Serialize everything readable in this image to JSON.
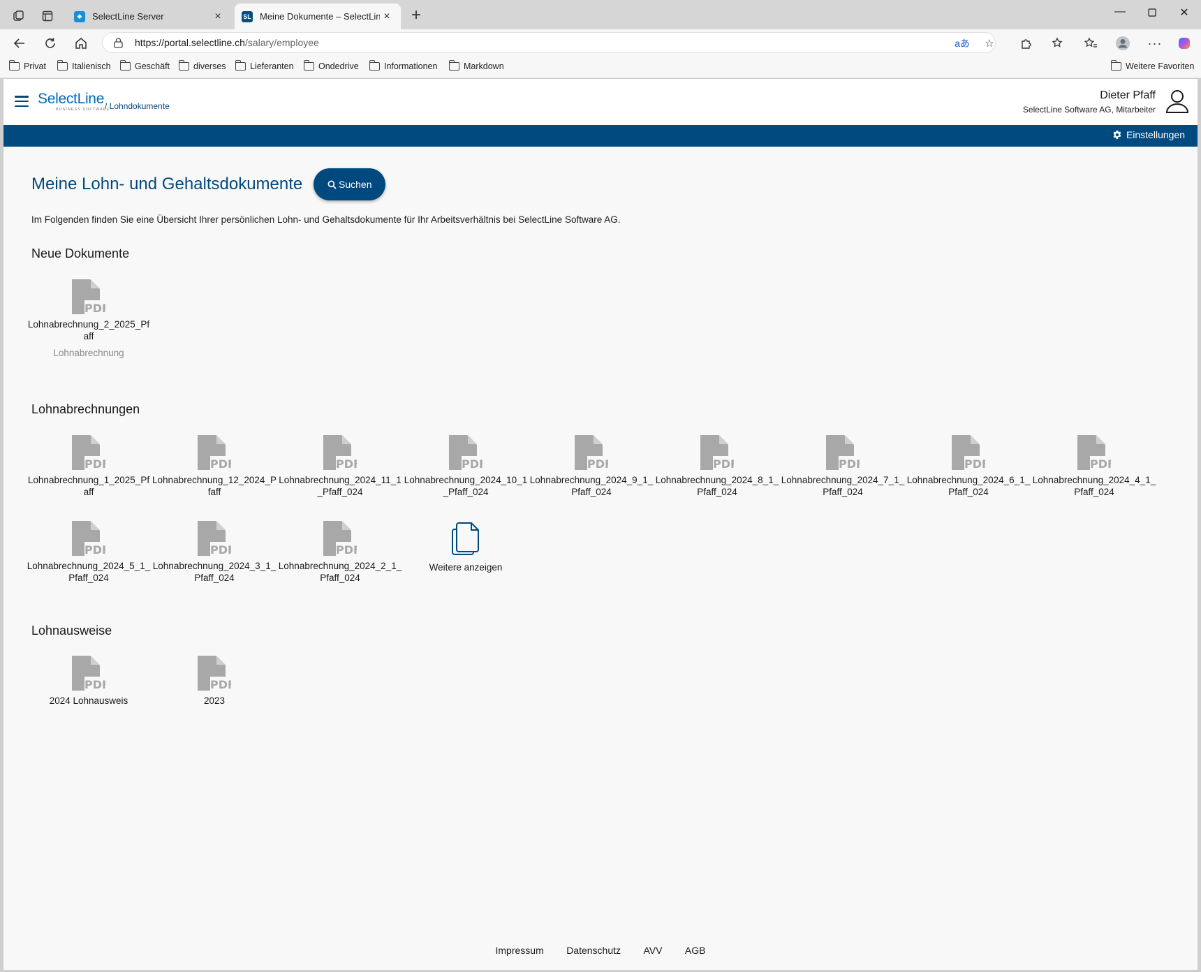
{
  "browser": {
    "tabs": [
      {
        "title": "SelectLine Server",
        "active": false
      },
      {
        "title": "Meine Dokumente – SelectLine Lohndokumente",
        "active": true
      }
    ],
    "url_host": "https://portal.selectline.ch",
    "url_path": "/salary/employee",
    "bookmarks": [
      "Privat",
      "Italienisch",
      "Geschäft",
      "diverses",
      "Lieferanten",
      "Ondedrive",
      "Informationen",
      "Markdown"
    ],
    "bookmarks_right": "Weitere Favoriten"
  },
  "header": {
    "brand": "SelectLine",
    "brand_sub": "BUSINESS SOFTWARE",
    "breadcrumb": "/ Lohndokumente",
    "user_name": "Dieter Pfaff",
    "user_role": "SelectLine Software AG, Mitarbeiter",
    "settings_label": "Einstellungen"
  },
  "main": {
    "title": "Meine Lohn- und Gehaltsdokumente",
    "search_label": "Suchen",
    "intro": "Im Folgenden finden Sie eine Übersicht Ihrer persönlichen Lohn- und Gehaltsdokumente für Ihr Arbeitsverhältnis bei SelectLine Software AG.",
    "sections": {
      "new_docs": {
        "title": "Neue Dokumente",
        "items": [
          {
            "name": "Lohnabrechnung_2_2025_Pfaff",
            "type": "Lohnabrechnung"
          }
        ]
      },
      "payslips": {
        "title": "Lohnabrechnungen",
        "items": [
          {
            "name": "Lohnabrechnung_1_2025_Pfaff"
          },
          {
            "name": "Lohnabrechnung_12_2024_Pfaff"
          },
          {
            "name": "Lohnabrechnung_2024_11_1_Pfaff_024"
          },
          {
            "name": "Lohnabrechnung_2024_10_1_Pfaff_024"
          },
          {
            "name": "Lohnabrechnung_2024_9_1_Pfaff_024"
          },
          {
            "name": "Lohnabrechnung_2024_8_1_Pfaff_024"
          },
          {
            "name": "Lohnabrechnung_2024_7_1_Pfaff_024"
          },
          {
            "name": "Lohnabrechnung_2024_6_1_Pfaff_024"
          },
          {
            "name": "Lohnabrechnung_2024_4_1_Pfaff_024"
          },
          {
            "name": "Lohnabrechnung_2024_5_1_Pfaff_024"
          },
          {
            "name": "Lohnabrechnung_2024_3_1_Pfaff_024"
          },
          {
            "name": "Lohnabrechnung_2024_2_1_Pfaff_024"
          }
        ],
        "more_label": "Weitere anzeigen"
      },
      "certificates": {
        "title": "Lohnausweise",
        "items": [
          {
            "name": "2024 Lohnausweis"
          },
          {
            "name": "2023"
          }
        ]
      }
    }
  },
  "footer": {
    "links": [
      "Impressum",
      "Datenschutz",
      "AVV",
      "AGB"
    ]
  },
  "colors": {
    "primary": "#00497e",
    "brand": "#0069b4",
    "pdf_icon": "#a8a8a8"
  }
}
